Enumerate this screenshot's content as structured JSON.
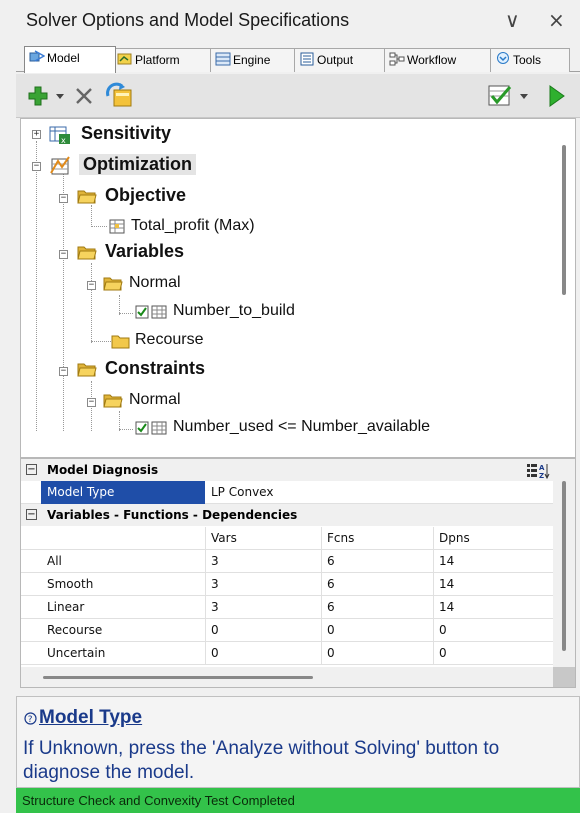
{
  "window": {
    "title": "Solver Options and Model Specifications",
    "minimize_glyph": "∨",
    "close_glyph": "×"
  },
  "tabs": [
    {
      "label": "Model",
      "icon": "model-icon",
      "active": true
    },
    {
      "label": "Platform",
      "icon": "platform-icon",
      "active": false
    },
    {
      "label": "Engine",
      "icon": "engine-icon",
      "active": false
    },
    {
      "label": "Output",
      "icon": "output-icon",
      "active": false
    },
    {
      "label": "Workflow",
      "icon": "workflow-icon",
      "active": false
    },
    {
      "label": "Tools",
      "icon": "tools-icon",
      "active": false
    }
  ],
  "toolbar": {
    "add_icon": "plus-icon",
    "delete_icon": "delete-x-icon",
    "refresh_icon": "refresh-model-icon",
    "check_icon": "check-model-icon",
    "run_icon": "run-play-icon"
  },
  "tree": {
    "sensitivity": "Sensitivity",
    "optimization": "Optimization",
    "objective": "Objective",
    "objective_item": "Total_profit (Max)",
    "variables": "Variables",
    "var_normal": "Normal",
    "var_item": "Number_to_build",
    "recourse": "Recourse",
    "constraints": "Constraints",
    "con_normal": "Normal",
    "con_item": "Number_used <= Number_available"
  },
  "grid": {
    "diagnosis_header": "Model Diagnosis",
    "model_type_label": "Model Type",
    "model_type_value": "LP Convex",
    "vfd_header": "Variables - Functions - Dependencies",
    "columns": [
      "Vars",
      "Fcns",
      "Dpns"
    ],
    "rows": [
      {
        "label": "All",
        "values": [
          "3",
          "6",
          "14"
        ]
      },
      {
        "label": "Smooth",
        "values": [
          "3",
          "6",
          "14"
        ]
      },
      {
        "label": "Linear",
        "values": [
          "3",
          "6",
          "14"
        ]
      },
      {
        "label": "Recourse",
        "values": [
          "0",
          "0",
          "0"
        ]
      },
      {
        "label": "Uncertain",
        "values": [
          "0",
          "0",
          "0"
        ]
      }
    ],
    "sort_icon": "sort-az-icon"
  },
  "help": {
    "title": "Model Type",
    "body": "If Unknown, press the 'Analyze without Solving' button to diagnose the model."
  },
  "status": {
    "text": "Structure Check and Convexity Test Completed",
    "color": "#33c24a"
  },
  "colors": {
    "selection": "#1f4ea8",
    "help_text": "#1a3a8a",
    "add_green": "#3aa335",
    "run_green": "#2fb02f"
  }
}
